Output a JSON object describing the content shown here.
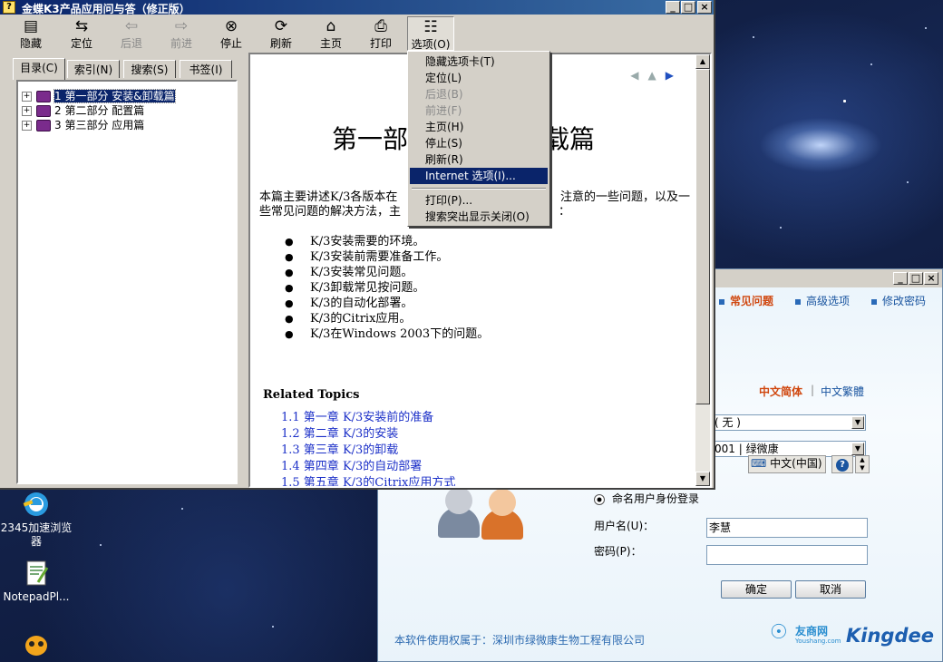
{
  "help_window": {
    "title": "金蝶K3产品应用问与答（修正版）",
    "toolbar": [
      {
        "label": "隐藏",
        "icon": "hide-icon",
        "enabled": true
      },
      {
        "label": "定位",
        "icon": "locate-icon",
        "enabled": true
      },
      {
        "label": "后退",
        "icon": "back-arrow-icon",
        "enabled": false
      },
      {
        "label": "前进",
        "icon": "forward-arrow-icon",
        "enabled": false
      },
      {
        "label": "停止",
        "icon": "stop-icon",
        "enabled": true
      },
      {
        "label": "刷新",
        "icon": "refresh-icon",
        "enabled": true
      },
      {
        "label": "主页",
        "icon": "home-icon",
        "enabled": true
      },
      {
        "label": "打印",
        "icon": "print-icon",
        "enabled": true
      },
      {
        "label": "选项(O)",
        "icon": "options-icon",
        "enabled": true
      }
    ],
    "tabs": [
      "目录(C)",
      "索引(N)",
      "搜索(S)",
      "书签(I)"
    ],
    "tree": [
      {
        "label": "1 第一部分 安装&卸载篇",
        "selected": true
      },
      {
        "label": "2 第二部分 配置篇",
        "selected": false
      },
      {
        "label": "3 第三部分 应用篇",
        "selected": false
      }
    ],
    "content": {
      "heading_left": "第一部",
      "heading_right": "卸载篇",
      "para_line1_left": "本篇主要讲述K/3各版本在",
      "para_line1_right": "注意的一些问题，以及一",
      "para_line2_left": "些常见问题的解决方法，主",
      "para_line2_right": "：",
      "bullets": [
        "K/3安装需要的环境。",
        "K/3安装前需要准备工作。",
        "K/3安装常见问题。",
        "K/3卸载常见按问题。",
        "K/3的自动化部署。",
        "K/3的Citrix应用。",
        "K/3在Windows 2003下的问题。"
      ],
      "related_title": "Related Topics",
      "related_links": [
        "1.1 第一章  K/3安装前的准备",
        "1.2 第二章  K/3的安装",
        "1.3 第三章  K/3的卸载",
        "1.4 第四章  K/3的自动部署",
        "1.5 第五章  K/3的Citrix应用方式"
      ]
    },
    "options_menu": [
      {
        "label": "隐藏选项卡(T)",
        "enabled": true
      },
      {
        "label": "定位(L)",
        "enabled": true
      },
      {
        "label": "后退(B)",
        "enabled": false
      },
      {
        "label": "前进(F)",
        "enabled": false
      },
      {
        "label": "主页(H)",
        "enabled": true
      },
      {
        "label": "停止(S)",
        "enabled": true
      },
      {
        "label": "刷新(R)",
        "enabled": true
      },
      {
        "label": "Internet 选项(I)...",
        "enabled": true,
        "highlighted": true
      },
      {
        "label": "打印(P)...",
        "enabled": true
      },
      {
        "label": "搜索突出显示关闭(O)",
        "enabled": true
      }
    ]
  },
  "desktop_icons": [
    {
      "label": "2345加速浏览器",
      "icon": "browser-icon"
    },
    {
      "label": "NotepadPl...",
      "icon": "notepad-icon"
    }
  ],
  "login_window": {
    "nav": [
      "常见问题",
      "高级选项",
      "修改密码"
    ],
    "lang_simplified": "中文简体",
    "lang_separator": "|",
    "lang_traditional": "中文繁體",
    "field1_value": "( 无 )",
    "field2_value": "001 | 绿微康",
    "locale_label": "中文(中国)",
    "login_mode": "命名用户身份登录",
    "username_label": "用户名(U)：",
    "username_value": "李慧",
    "password_label": "密码(P)：",
    "password_value": "",
    "ok_label": "确定",
    "cancel_label": "取消",
    "owner_text": "本软件使用权属于：深圳市绿微康生物工程有限公司",
    "logo_youshang": "友商网",
    "logo_youshang_sub": "Youshang.com",
    "logo_kingdee": "Kingdee"
  },
  "colors": {
    "title_bar": "#0a246a",
    "link": "#1c30c8",
    "menu_highlight": "#0a246a",
    "kingdee_blue": "#1d5fb0",
    "nav_hot": "#d0470f"
  }
}
